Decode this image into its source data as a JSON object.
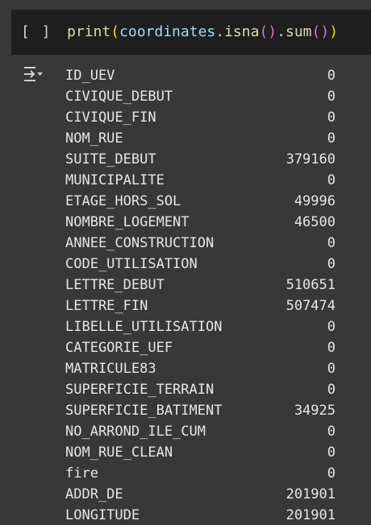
{
  "cell": {
    "run_bracket": "[ ]",
    "code": {
      "fn": "print",
      "open": "(",
      "var": "coordinates",
      "dot1": ".",
      "method1": "isna",
      "call1": "()",
      "dot2": ".",
      "method2": "sum",
      "call2": "()",
      "close": ")"
    }
  },
  "output": {
    "icon": "output-collapse-icon",
    "rows": [
      {
        "key": "ID_UEV",
        "value": "0"
      },
      {
        "key": "CIVIQUE_DEBUT",
        "value": "0"
      },
      {
        "key": "CIVIQUE_FIN",
        "value": "0"
      },
      {
        "key": "NOM_RUE",
        "value": "0"
      },
      {
        "key": "SUITE_DEBUT",
        "value": "379160"
      },
      {
        "key": "MUNICIPALITE",
        "value": "0"
      },
      {
        "key": "ETAGE_HORS_SOL",
        "value": "49996"
      },
      {
        "key": "NOMBRE_LOGEMENT",
        "value": "46500"
      },
      {
        "key": "ANNEE_CONSTRUCTION",
        "value": "0"
      },
      {
        "key": "CODE_UTILISATION",
        "value": "0"
      },
      {
        "key": "LETTRE_DEBUT",
        "value": "510651"
      },
      {
        "key": "LETTRE_FIN",
        "value": "507474"
      },
      {
        "key": "LIBELLE_UTILISATION",
        "value": "0"
      },
      {
        "key": "CATEGORIE_UEF",
        "value": "0"
      },
      {
        "key": "MATRICULE83",
        "value": "0"
      },
      {
        "key": "SUPERFICIE_TERRAIN",
        "value": "0"
      },
      {
        "key": "SUPERFICIE_BATIMENT",
        "value": "34925"
      },
      {
        "key": "NO_ARROND_ILE_CUM",
        "value": "0"
      },
      {
        "key": "NOM_RUE_CLEAN",
        "value": "0"
      },
      {
        "key": "fire",
        "value": "0"
      },
      {
        "key": "ADDR_DE",
        "value": "201901"
      },
      {
        "key": "LONGITUDE",
        "value": "201901"
      }
    ]
  }
}
